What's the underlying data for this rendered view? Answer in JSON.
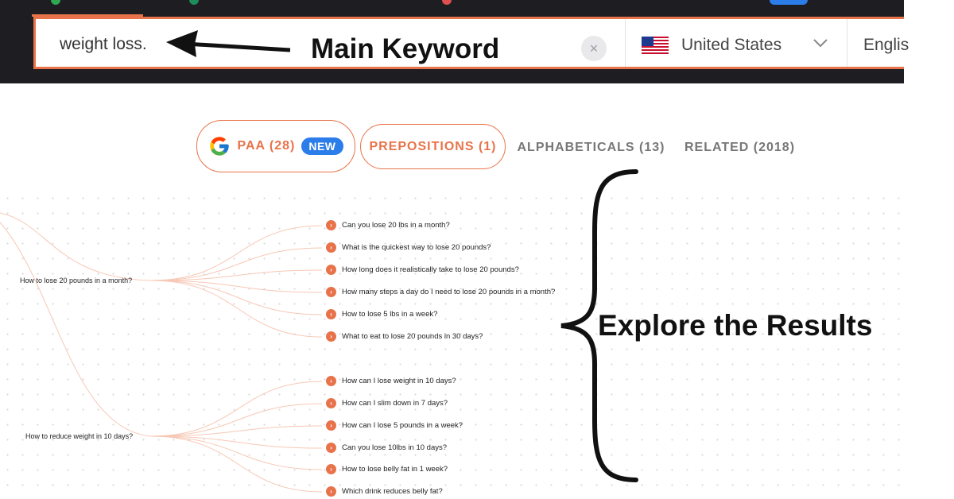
{
  "search": {
    "query": "weight loss.",
    "clear_label": "×",
    "country": "United States",
    "language": "Englis"
  },
  "annotations": {
    "main_keyword": "Main Keyword",
    "explore": "Explore the Results"
  },
  "tabs": [
    {
      "label": "PAA (28)",
      "badge": "NEW"
    },
    {
      "label": "PREPOSITIONS (1)"
    },
    {
      "label": "ALPHABETICALS (13)"
    },
    {
      "label": "RELATED (2018)"
    }
  ],
  "groups": [
    {
      "root": "How to lose 20 pounds in a month?",
      "children": [
        "Can you lose 20 lbs in a month?",
        "What is the quickest way to lose 20 pounds?",
        "How long does it realistically take to lose 20 pounds?",
        "How many steps a day do I need to lose 20 pounds in a month?",
        "How to lose 5 lbs in a week?",
        "What to eat to lose 20 pounds in 30 days?"
      ]
    },
    {
      "root": "How to reduce weight in 10 days?",
      "children": [
        "How can I lose weight in 10 days?",
        "How can I slim down in 7 days?",
        "How can I lose 5 pounds in a week?",
        "Can you lose 10lbs in 10 days?",
        "How to lose belly fat in 1 week?",
        "Which drink reduces belly fat?"
      ]
    }
  ],
  "colors": {
    "accent": "#e8734a",
    "topbar": "#1e1e22",
    "badge": "#2b7de9"
  }
}
